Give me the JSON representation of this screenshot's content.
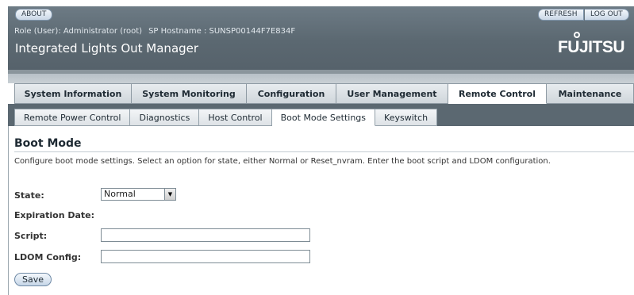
{
  "header": {
    "about_label": "ABOUT",
    "refresh_label": "REFRESH",
    "logout_label": "LOG OUT",
    "role_text": "Role (User): Administrator (root)",
    "sp_hostname_text": "SP Hostname : SUNSP00144F7E834F",
    "app_title": "Integrated Lights Out Manager",
    "logo_text": "FUJITSU"
  },
  "tabs": [
    {
      "label": "System Information",
      "active": false
    },
    {
      "label": "System Monitoring",
      "active": false
    },
    {
      "label": "Configuration",
      "active": false
    },
    {
      "label": "User Management",
      "active": false
    },
    {
      "label": "Remote Control",
      "active": true
    },
    {
      "label": "Maintenance",
      "active": false
    }
  ],
  "subtabs": [
    {
      "label": "Remote Power Control",
      "active": false
    },
    {
      "label": "Diagnostics",
      "active": false
    },
    {
      "label": "Host Control",
      "active": false
    },
    {
      "label": "Boot Mode Settings",
      "active": true
    },
    {
      "label": "Keyswitch",
      "active": false
    }
  ],
  "page": {
    "title": "Boot Mode",
    "description": "Configure boot mode settings. Select an option for state, either Normal or Reset_nvram. Enter the boot script and LDOM configuration."
  },
  "form": {
    "state_label": "State:",
    "state_value": "Normal",
    "expiration_label": "Expiration Date:",
    "script_label": "Script:",
    "script_value": "",
    "ldom_label": "LDOM Config:",
    "ldom_value": "",
    "save_label": "Save"
  },
  "colors": {
    "header_bg": "#5b6871",
    "tab_active_bg": "#ffffff",
    "button_bg": "#c6d6e8"
  }
}
